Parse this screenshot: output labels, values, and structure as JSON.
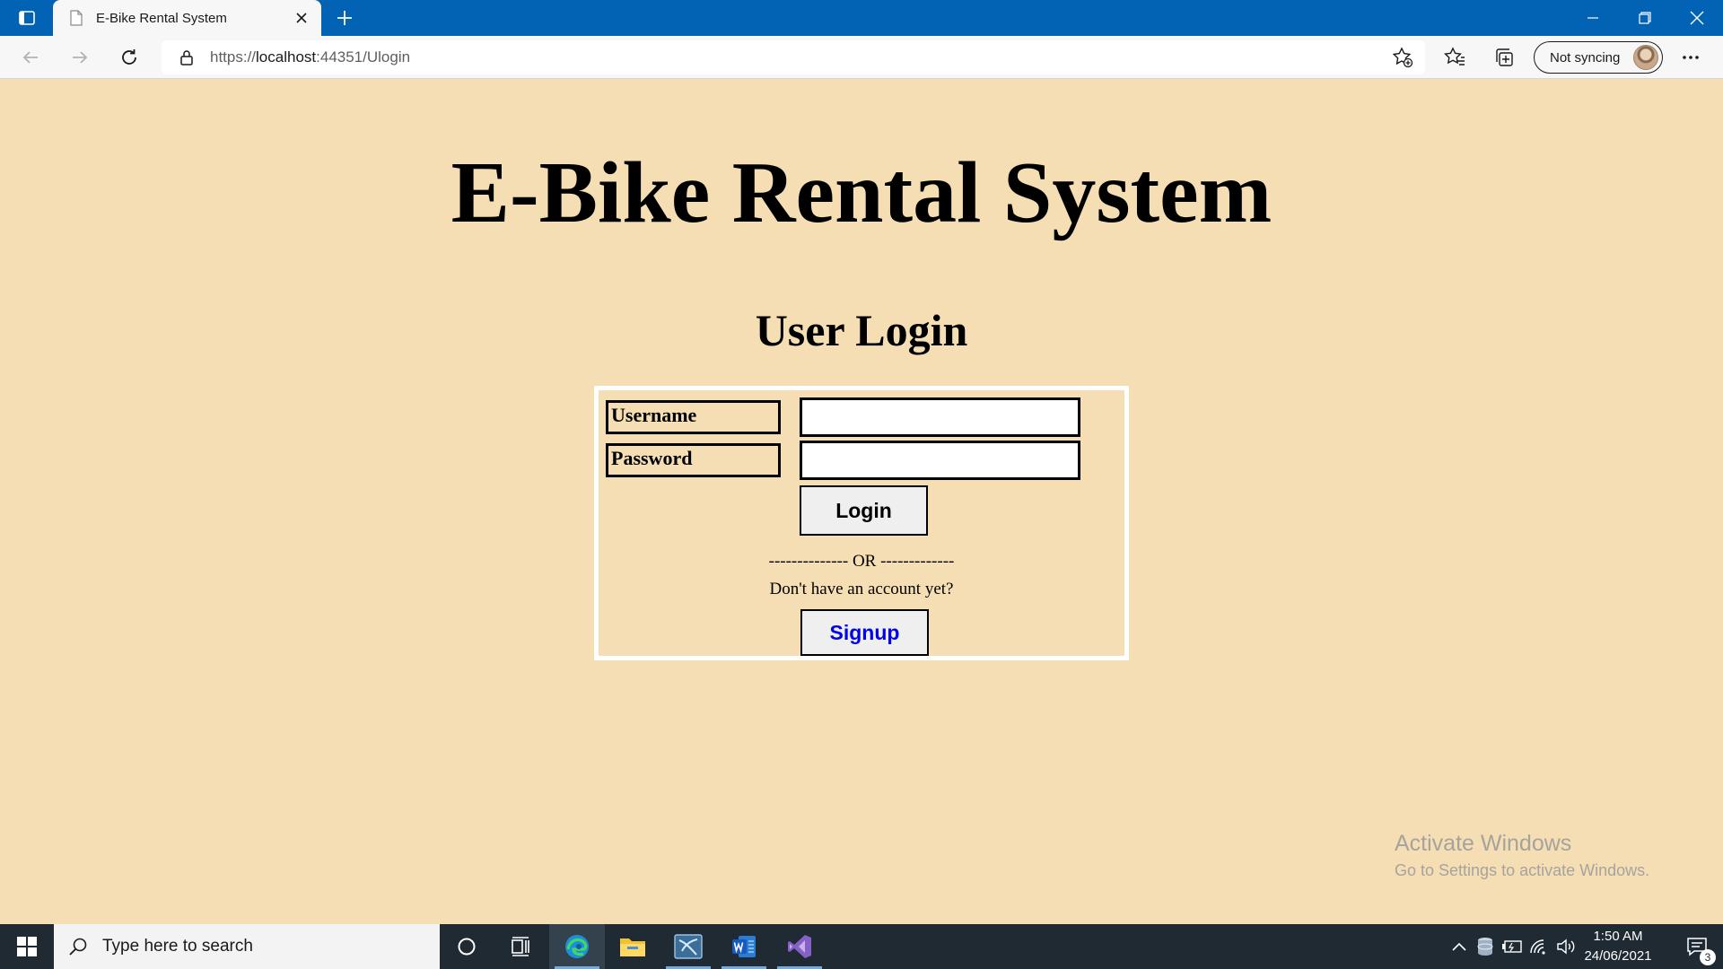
{
  "browser": {
    "tab_title": "E-Bike Rental System",
    "url_prefix": "https://",
    "url_host": "localhost",
    "url_path": ":44351/Ulogin",
    "profile_label": "Not syncing"
  },
  "page": {
    "title": "E-Bike Rental System",
    "subtitle": "User Login"
  },
  "login_form": {
    "username_label": "Username",
    "username_value": "",
    "password_label": "Password",
    "password_value": "",
    "login_button": "Login",
    "or_separator": "-------------- OR -------------",
    "no_account_text": "Don't have an account yet?",
    "signup_button": "Signup"
  },
  "watermark": {
    "title": "Activate Windows",
    "subtitle": "Go to Settings to activate Windows."
  },
  "taskbar": {
    "search_placeholder": "Type here to search",
    "time": "1:50 AM",
    "date": "24/06/2021",
    "notification_count": "3",
    "apps": [
      "cortana-icon",
      "task-view-icon",
      "edge-icon",
      "file-explorer-icon",
      "mysql-workbench-icon",
      "word-icon",
      "visual-studio-icon"
    ]
  },
  "colors": {
    "page_background": "#f5deb3",
    "titlebar": "#0263b5",
    "taskbar": "#1f2a33",
    "signup_text": "#0000ee"
  }
}
